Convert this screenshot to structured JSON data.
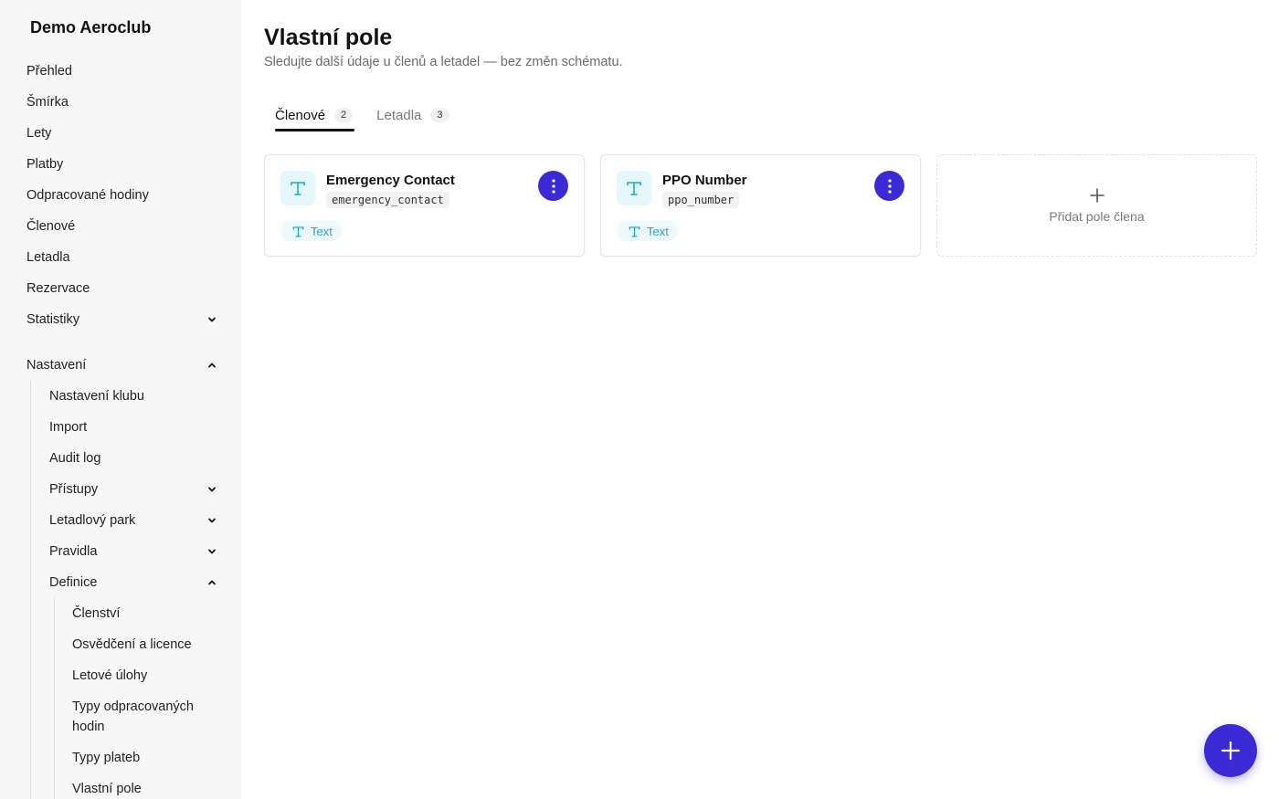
{
  "sidebar": {
    "brand": "Demo Aeroclub",
    "items": [
      {
        "label": "Přehled"
      },
      {
        "label": "Šmírka"
      },
      {
        "label": "Lety"
      },
      {
        "label": "Platby"
      },
      {
        "label": "Odpracované hodiny"
      },
      {
        "label": "Členové"
      },
      {
        "label": "Letadla"
      },
      {
        "label": "Rezervace"
      },
      {
        "label": "Statistiky",
        "chevron": "chevron-down-icon"
      }
    ],
    "settings": {
      "label": "Nastavení",
      "chevron": "chevron-up-icon",
      "items": [
        {
          "label": "Nastavení klubu"
        },
        {
          "label": "Import"
        },
        {
          "label": "Audit log"
        },
        {
          "label": "Přístupy",
          "chevron": "chevron-down-icon"
        },
        {
          "label": "Letadlový park",
          "chevron": "chevron-down-icon"
        },
        {
          "label": "Pravidla",
          "chevron": "chevron-down-icon"
        },
        {
          "label": "Definice",
          "chevron": "chevron-up-icon"
        }
      ],
      "definitions": [
        {
          "label": "Členství"
        },
        {
          "label": "Osvědčení a licence"
        },
        {
          "label": "Letové úlohy"
        },
        {
          "label": "Typy odpracovaných hodin"
        },
        {
          "label": "Typy plateb"
        },
        {
          "label": "Vlastní pole"
        }
      ]
    }
  },
  "main": {
    "title": "Vlastní pole",
    "subtitle": "Sledujte další údaje u členů a letadel — bez změn schématu.",
    "tabs": [
      {
        "label": "Členové",
        "count": "2",
        "active": true
      },
      {
        "label": "Letadla",
        "count": "3",
        "active": false
      }
    ],
    "fields": [
      {
        "name": "Emergency Contact",
        "key": "emergency_contact",
        "type": "Text",
        "icon": "text-type-icon"
      },
      {
        "name": "PPO Number",
        "key": "ppo_number",
        "type": "Text",
        "icon": "text-type-icon"
      }
    ],
    "add_field_label": "Přidat pole člena"
  },
  "colors": {
    "accent": "#3b2bd6",
    "type_text": "#18a7d8",
    "type_bg": "#e4f7fd",
    "sidebar_bg": "#f7f7f8"
  }
}
